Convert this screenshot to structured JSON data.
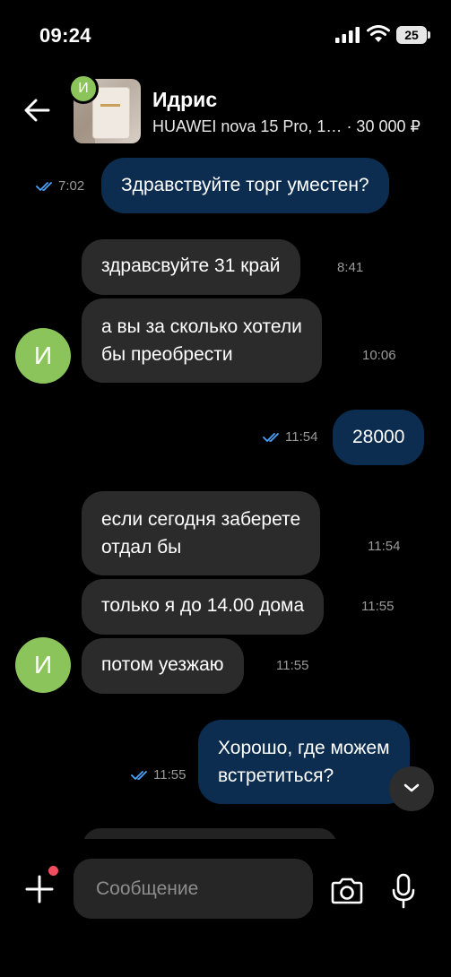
{
  "status_bar": {
    "time": "09:24",
    "battery": "25"
  },
  "header": {
    "avatar_initial": "И",
    "contact_name": "Идрис",
    "listing_title": "HUAWEI nova 15 Pro, 1…",
    "listing_price": "· 30 000 ₽"
  },
  "messages": [
    {
      "id": "m1",
      "direction": "out",
      "text": "Здравствуйте торг уместен?",
      "time": "7:02",
      "read": true
    },
    {
      "id": "m2",
      "direction": "in",
      "text": "здравсвуйте 31 край",
      "time": "8:41"
    },
    {
      "id": "m3",
      "direction": "in",
      "lines": [
        "а вы за сколько хотели",
        "бы преобрести"
      ],
      "time": "10:06"
    },
    {
      "id": "m4",
      "direction": "out",
      "text": "28000",
      "time": "11:54",
      "read": true
    },
    {
      "id": "m5",
      "direction": "in",
      "lines": [
        "если сегодня заберете",
        "отдал бы"
      ],
      "time": "11:54"
    },
    {
      "id": "m6",
      "direction": "in",
      "text": "только я до 14.00 дома",
      "time": "11:55"
    },
    {
      "id": "m7",
      "direction": "in",
      "text": "потом уезжаю",
      "time": "11:55"
    },
    {
      "id": "m8",
      "direction": "out",
      "lines": [
        "Хорошо, где можем",
        "встретиться?"
      ],
      "time": "11:55",
      "read": true
    }
  ],
  "sender_avatar_initial": "И",
  "composer": {
    "placeholder": "Сообщение",
    "attach_has_notification": true
  },
  "colors": {
    "incoming": "#2b2b2b",
    "outgoing": "#0c2d4f",
    "read_ticks": "#4aa3ff",
    "avatar": "#8bc45a",
    "notification_dot": "#f04e5e"
  },
  "icons": [
    "back-arrow-icon",
    "plus-icon",
    "camera-icon",
    "microphone-icon",
    "chevron-down-icon",
    "double-check-icon"
  ]
}
